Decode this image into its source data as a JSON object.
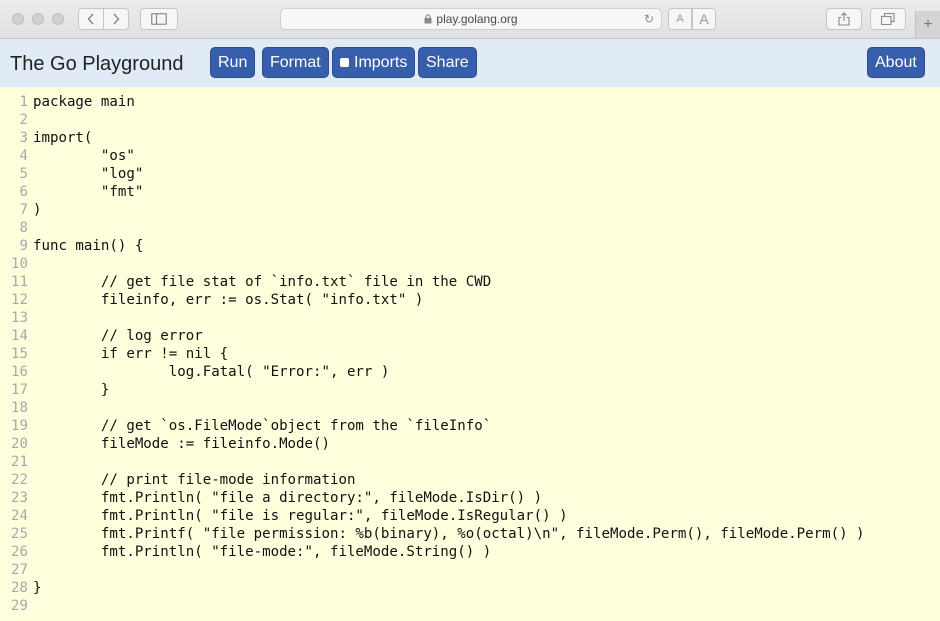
{
  "browser": {
    "url": "play.golang.org",
    "reader_small": "A",
    "reader_large": "A",
    "new_tab": "+"
  },
  "header": {
    "title": "The Go Playground",
    "buttons": {
      "run": "Run",
      "format": "Format",
      "imports": "Imports",
      "share": "Share",
      "about": "About"
    },
    "imports_checked": false,
    "accent_color": "#375eab",
    "bar_color": "#e0ebf5"
  },
  "editor": {
    "background": "#ffffdd",
    "lines": [
      {
        "n": "1",
        "text": "package main"
      },
      {
        "n": "2",
        "text": ""
      },
      {
        "n": "3",
        "text": "import("
      },
      {
        "n": "4",
        "text": "        \"os\""
      },
      {
        "n": "5",
        "text": "        \"log\""
      },
      {
        "n": "6",
        "text": "        \"fmt\""
      },
      {
        "n": "7",
        "text": ")"
      },
      {
        "n": "8",
        "text": ""
      },
      {
        "n": "9",
        "text": "func main() {"
      },
      {
        "n": "10",
        "text": ""
      },
      {
        "n": "11",
        "text": "        // get file stat of `info.txt` file in the CWD"
      },
      {
        "n": "12",
        "text": "        fileinfo, err := os.Stat( \"info.txt\" )"
      },
      {
        "n": "13",
        "text": ""
      },
      {
        "n": "14",
        "text": "        // log error"
      },
      {
        "n": "15",
        "text": "        if err != nil {"
      },
      {
        "n": "16",
        "text": "                log.Fatal( \"Error:\", err )"
      },
      {
        "n": "17",
        "text": "        }"
      },
      {
        "n": "18",
        "text": ""
      },
      {
        "n": "19",
        "text": "        // get `os.FileMode`object from the `fileInfo`"
      },
      {
        "n": "20",
        "text": "        fileMode := fileinfo.Mode()"
      },
      {
        "n": "21",
        "text": ""
      },
      {
        "n": "22",
        "text": "        // print file-mode information"
      },
      {
        "n": "23",
        "text": "        fmt.Println( \"file a directory:\", fileMode.IsDir() )"
      },
      {
        "n": "24",
        "text": "        fmt.Println( \"file is regular:\", fileMode.IsRegular() )"
      },
      {
        "n": "25",
        "text": "        fmt.Printf( \"file permission: %b(binary), %o(octal)\\n\", fileMode.Perm(), fileMode.Perm() )"
      },
      {
        "n": "26",
        "text": "        fmt.Println( \"file-mode:\", fileMode.String() )"
      },
      {
        "n": "27",
        "text": ""
      },
      {
        "n": "28",
        "text": "}"
      },
      {
        "n": "29",
        "text": ""
      }
    ]
  }
}
